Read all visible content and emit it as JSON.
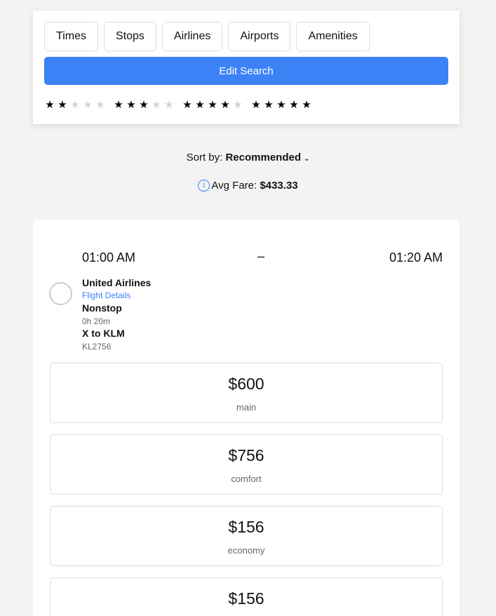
{
  "filters": {
    "buttons": [
      "Times",
      "Stops",
      "Airlines",
      "Airports",
      "Amenities"
    ],
    "edit_search_label": "Edit Search",
    "star_ratings": [
      {
        "rating": 2,
        "max": 5
      },
      {
        "rating": 3,
        "max": 5
      },
      {
        "rating": 4,
        "max": 5
      },
      {
        "rating": 5,
        "max": 5
      }
    ]
  },
  "sort": {
    "label": "Sort by:",
    "value": "Recommended"
  },
  "avg_fare": {
    "label": "Avg Fare:",
    "value": "$433.33"
  },
  "flight": {
    "depart_time": "01:00 AM",
    "separator": "–",
    "arrive_time": "01:20 AM",
    "airline": "United Airlines",
    "details_link": "Flight Details",
    "stops": "Nonstop",
    "duration": "0h 20m",
    "route": "X to KLM",
    "flight_number": "KL2756",
    "fares": [
      {
        "price": "$600",
        "class": "main"
      },
      {
        "price": "$756",
        "class": "comfort"
      },
      {
        "price": "$156",
        "class": "economy"
      },
      {
        "price": "$156",
        "class": ""
      }
    ]
  },
  "colors": {
    "accent": "#3b82f6",
    "background": "#f3f3f3"
  }
}
